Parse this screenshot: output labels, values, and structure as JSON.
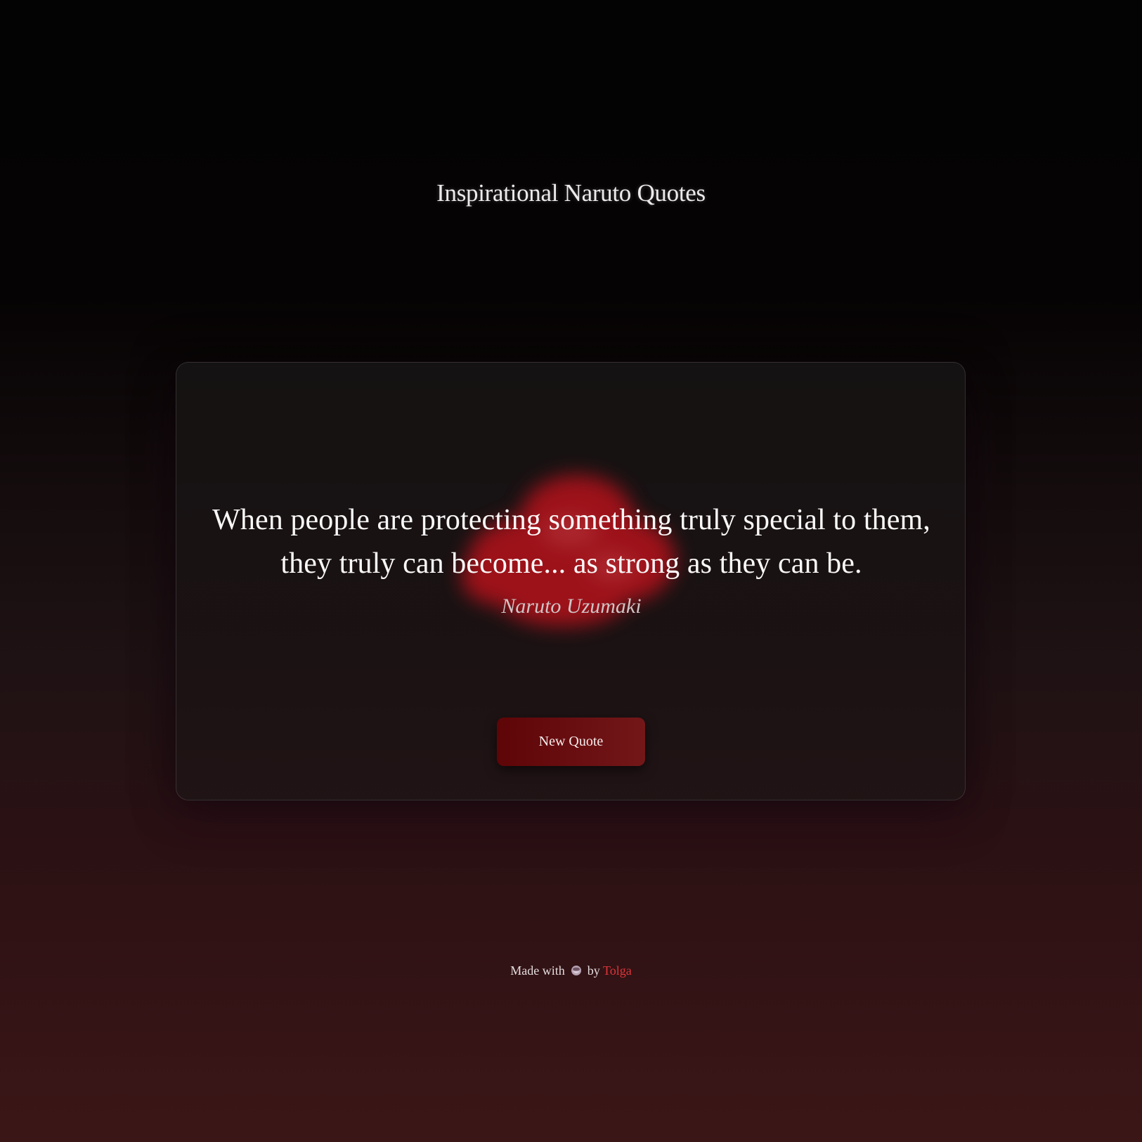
{
  "page": {
    "title": "Inspirational Naruto Quotes"
  },
  "card": {
    "quote": "When people are protecting something truly special to them, they truly can become... as strong as they can be.",
    "author": "Naruto Uzumaki",
    "new_quote_button": "New Quote",
    "background_icon": "akatsuki-cloud-icon"
  },
  "footer": {
    "prefix": "Made with",
    "icon": "coffee-icon",
    "by": "by",
    "author_link": "Tolga"
  },
  "colors": {
    "accent": "#e0353a",
    "button": "#6a0d0f",
    "cloud": "#b5121b"
  }
}
